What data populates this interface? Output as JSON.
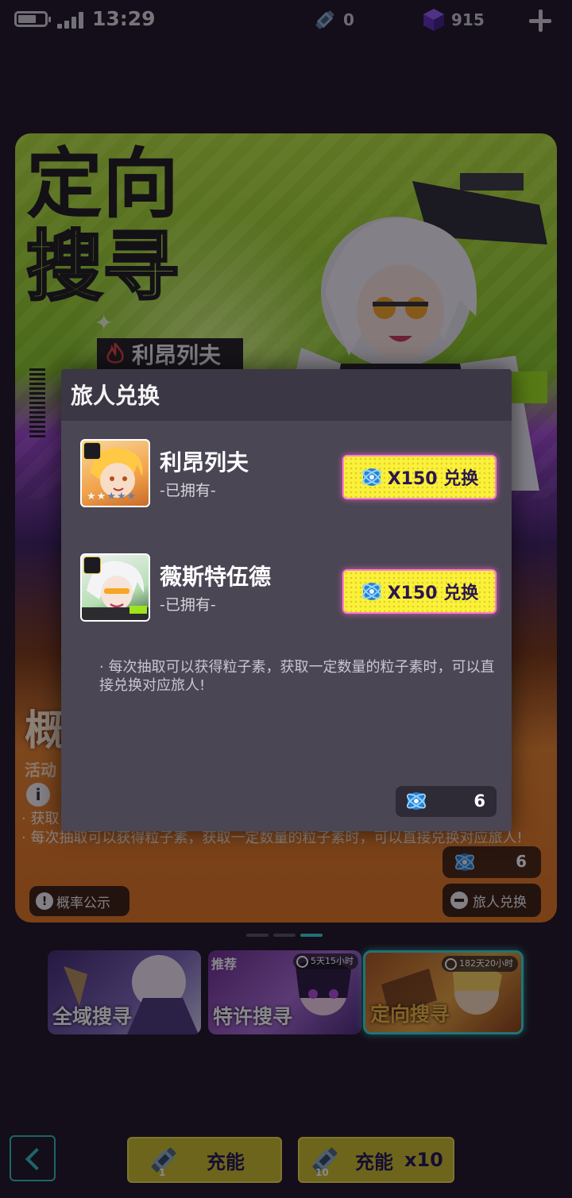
{
  "status_bar": {
    "time": "13:29"
  },
  "resources": {
    "ticket_count": "0",
    "gem_count": "915"
  },
  "banner": {
    "title_line1": "定向",
    "title_line2": "搜寻",
    "character_name": "利昂列夫",
    "overlay_title": "概",
    "activity_label": "活动",
    "desc_line1": "· 获取",
    "desc_line2": "· 每次抽取可以获得粒子素，获取一定数量的粒子素时，可以直接兑换对应旅人!",
    "particle_count": "6",
    "probability_label": "概率公示",
    "exchange_label": "旅人兑换"
  },
  "modal": {
    "title": "旅人兑换",
    "items": [
      {
        "name": "利昂列夫",
        "status": "-已拥有-",
        "button_label": "X150 兑换"
      },
      {
        "name": "薇斯特伍德",
        "status": "-已拥有-",
        "button_label": "X150 兑换"
      }
    ],
    "note": "· 每次抽取可以获得粒子素，获取一定数量的粒子素时，可以直接兑换对应旅人!",
    "balance": "6"
  },
  "tabs": [
    {
      "label": "全域搜寻",
      "tag": "",
      "timer": ""
    },
    {
      "label": "特许搜寻",
      "tag": "推荐",
      "timer": "5天15小时"
    },
    {
      "label": "定向搜寻",
      "tag": "",
      "timer": "182天20小时"
    }
  ],
  "bottom": {
    "charge_label": "充能",
    "charge_qty": "1",
    "charge10_label": "充能",
    "charge10_mult": "x10",
    "charge10_qty": "10"
  },
  "colors": {
    "accent": "#35d9d3",
    "button_yellow": "#fbf13a",
    "modal_bg": "#4a4654"
  },
  "icons": [
    "battery-icon",
    "signal-icon",
    "ticket-icon",
    "gem-icon",
    "plus-icon",
    "particle-icon",
    "back-icon"
  ]
}
